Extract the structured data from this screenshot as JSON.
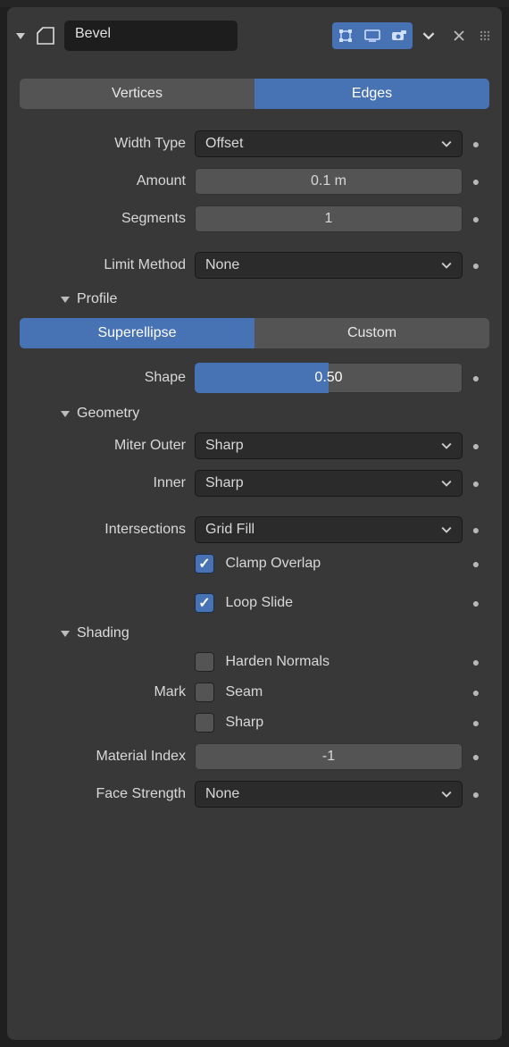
{
  "header": {
    "name": "Bevel",
    "display_realtime_on": true,
    "display_render_on": true,
    "display_editmode_on": false,
    "display_cage_on": true
  },
  "affect_tabs": {
    "options": [
      "Vertices",
      "Edges"
    ],
    "active": 1,
    "vertices_label": "Vertices",
    "edges_label": "Edges"
  },
  "fields": {
    "width_type_label": "Width Type",
    "width_type_value": "Offset",
    "amount_label": "Amount",
    "amount_value": "0.1 m",
    "segments_label": "Segments",
    "segments_value": "1",
    "limit_method_label": "Limit Method",
    "limit_method_value": "None"
  },
  "profile": {
    "section_label": "Profile",
    "superellipse_label": "Superellipse",
    "custom_label": "Custom",
    "active": 0,
    "shape_label": "Shape",
    "shape_value": "0.50",
    "shape_fraction": 0.5
  },
  "geometry": {
    "section_label": "Geometry",
    "miter_outer_label": "Miter Outer",
    "miter_outer_value": "Sharp",
    "inner_label": "Inner",
    "inner_value": "Sharp",
    "intersections_label": "Intersections",
    "intersections_value": "Grid Fill",
    "clamp_overlap_label": "Clamp Overlap",
    "clamp_overlap_checked": true,
    "loop_slide_label": "Loop Slide",
    "loop_slide_checked": true
  },
  "shading": {
    "section_label": "Shading",
    "harden_normals_label": "Harden Normals",
    "harden_normals_checked": false,
    "mark_label": "Mark",
    "seam_label": "Seam",
    "seam_checked": false,
    "sharp_label": "Sharp",
    "sharp_checked": false,
    "material_index_label": "Material Index",
    "material_index_value": "-1",
    "face_strength_label": "Face Strength",
    "face_strength_value": "None"
  }
}
